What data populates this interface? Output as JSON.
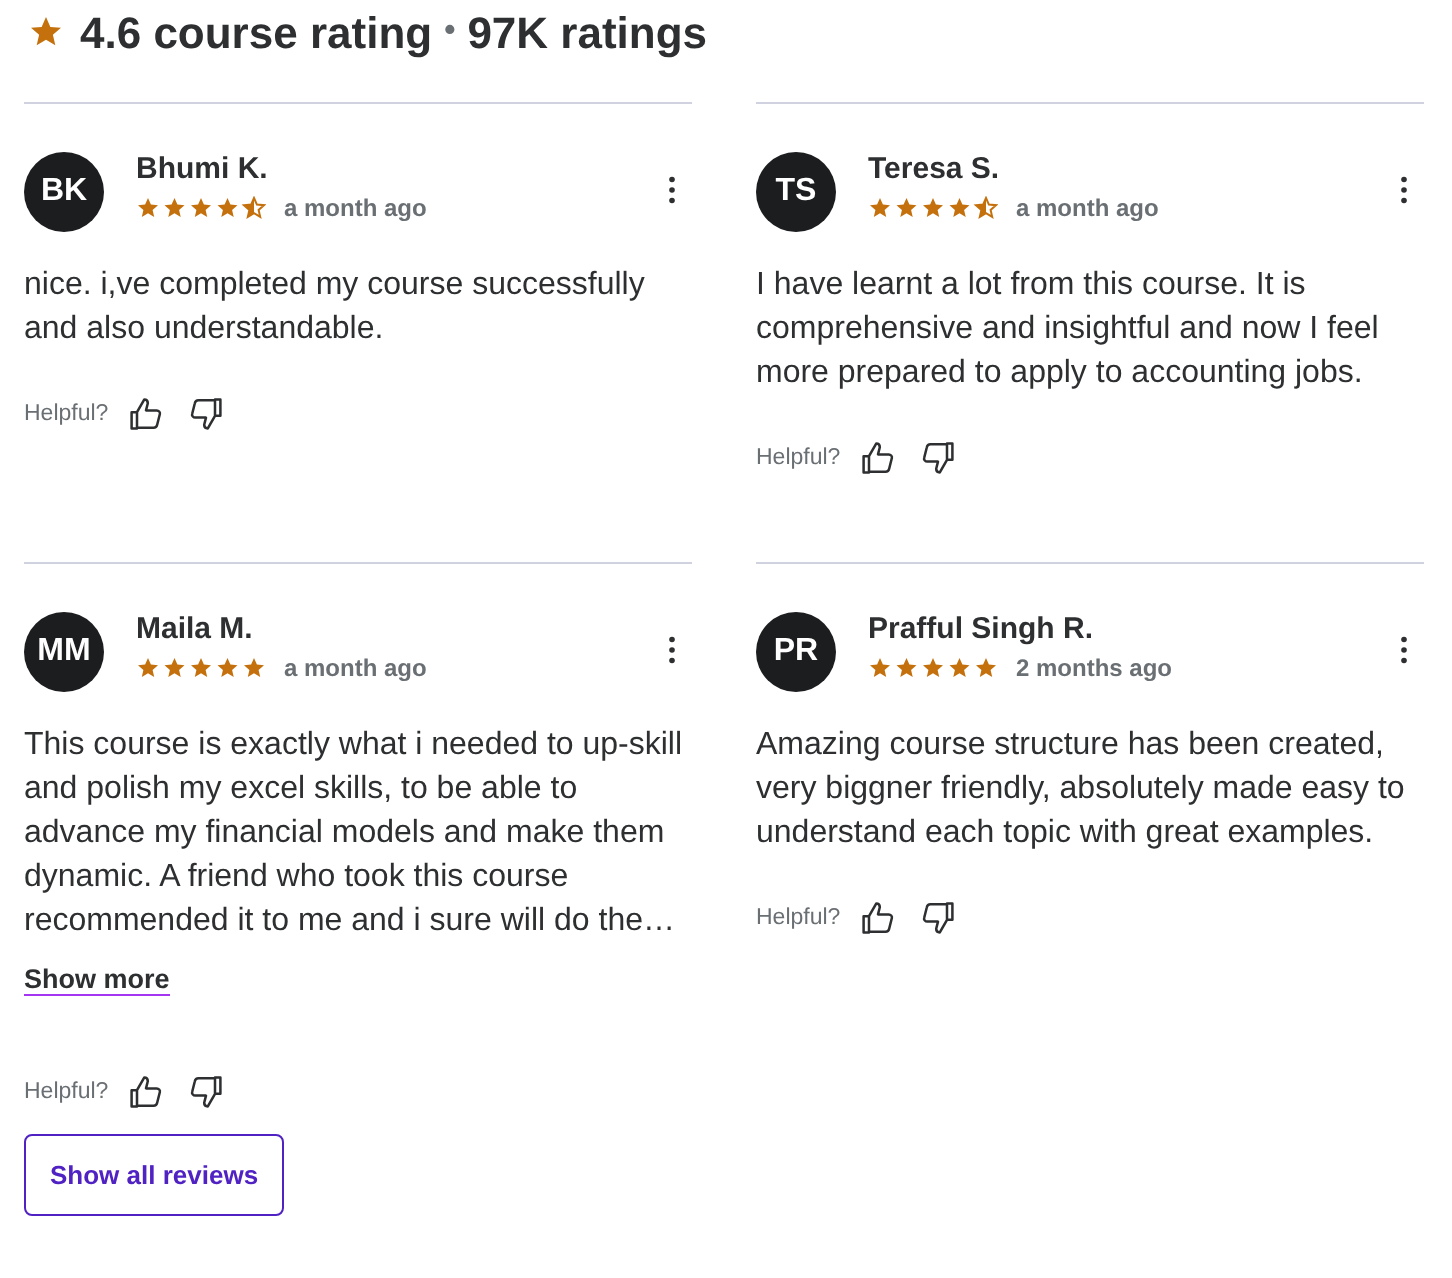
{
  "header": {
    "rating": "4.6 course rating",
    "separator": "•",
    "count": "97K ratings"
  },
  "reviews": [
    {
      "initials": "BK",
      "name": "Bhumi K.",
      "stars": 4.5,
      "time": "a month ago",
      "text": "nice. i,ve completed my course successfully and also understandable.",
      "helpful": "Helpful?"
    },
    {
      "initials": "TS",
      "name": "Teresa S.",
      "stars": 4.5,
      "time": "a month ago",
      "text": "I have learnt a lot from this course. It is comprehensive and insightful and now I feel more prepared to apply to accounting jobs.",
      "helpful": "Helpful?"
    },
    {
      "initials": "MM",
      "name": "Maila M.",
      "stars": 5,
      "time": "a month ago",
      "text": "This course is exactly what i needed to up-skill and polish my excel skills, to be able to advance my financial models and make them dynamic. A friend who took this course recommended it to me and i sure will do the…",
      "more": "Show more",
      "helpful": "Helpful?"
    },
    {
      "initials": "PR",
      "name": "Prafful Singh R.",
      "stars": 5,
      "time": "2 months ago",
      "text": "Amazing course structure has been created, very biggner friendly, absolutely made easy to understand each topic with great examples.",
      "helpful": "Helpful?"
    }
  ],
  "button": "Show all reviews"
}
